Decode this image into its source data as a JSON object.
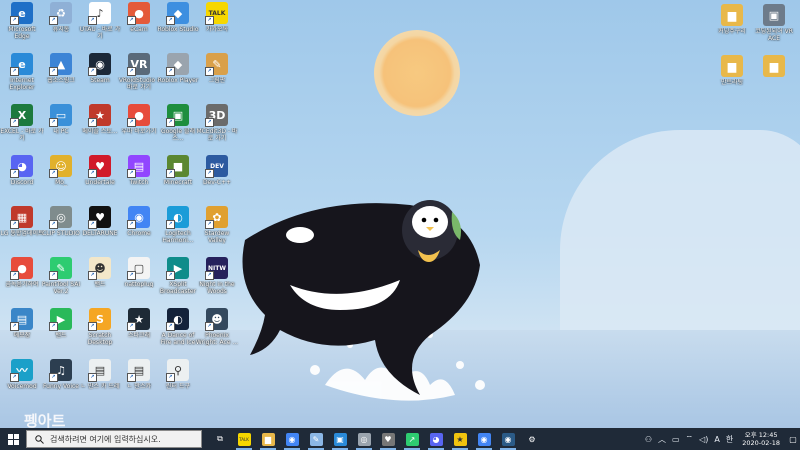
{
  "wallpaper": {
    "brand_text": "펭아트"
  },
  "desktop_icons": [
    {
      "label": "Microsoft Edge",
      "icon": "edge-icon",
      "color": "#1e6fc7",
      "glyph": "e"
    },
    {
      "label": "휴지통",
      "icon": "recycle-bin-icon",
      "color": "#8fb0d6",
      "glyph": "♻"
    },
    {
      "label": "UTAU - 바로 가기",
      "icon": "utau-icon",
      "color": "#ffffff",
      "glyph": "♪"
    },
    {
      "label": "eCam",
      "icon": "ecam-icon",
      "color": "#e45a3a",
      "glyph": "●"
    },
    {
      "label": "Roblox Studio",
      "icon": "roblox-studio-icon",
      "color": "#3d8fe0",
      "glyph": "◆"
    },
    {
      "label": "카카오톡",
      "icon": "kakaotalk-icon",
      "color": "#f6d700",
      "glyph": "TALK"
    },
    {
      "label": "Internet Explorer",
      "icon": "ie-icon",
      "color": "#2a8ad8",
      "glyph": "e"
    },
    {
      "label": "웹소스링크",
      "icon": "folder-link-icon",
      "color": "#3c84d6",
      "glyph": "▲"
    },
    {
      "label": "Steam",
      "icon": "steam-icon",
      "color": "#1b2838",
      "glyph": "◉"
    },
    {
      "label": "VRoidStudio - 바로 가기",
      "icon": "vroid-icon",
      "color": "#5a6a7a",
      "glyph": "VR"
    },
    {
      "label": "Roblox Player",
      "icon": "roblox-player-icon",
      "color": "#9aa4ae",
      "glyph": "◆"
    },
    {
      "label": "그림판",
      "icon": "paint-icon",
      "color": "#d9a04a",
      "glyph": "✎"
    },
    {
      "label": "EXCEL - 바로 가기",
      "icon": "excel-icon",
      "color": "#1d7a3e",
      "glyph": "X"
    },
    {
      "label": "내 PC",
      "icon": "this-pc-icon",
      "color": "#3a90d9",
      "glyph": "▭"
    },
    {
      "label": "메이플 스토...",
      "icon": "maplestory-icon",
      "color": "#c0392b",
      "glyph": "★"
    },
    {
      "label": "우마 바로가기",
      "icon": "uma-icon",
      "color": "#e74c3c",
      "glyph": "●"
    },
    {
      "label": "Google 클래스...",
      "icon": "google-classroom-icon",
      "color": "#1e8e3e",
      "glyph": "▣"
    },
    {
      "label": "MCEdit3D - 바로 가기",
      "icon": "3d-builder-icon",
      "color": "#6b6b6b",
      "glyph": "3D"
    },
    {
      "label": "Discord",
      "icon": "discord-icon",
      "color": "#5865f2",
      "glyph": "◕"
    },
    {
      "label": "Mo_",
      "icon": "user-folder-icon",
      "color": "#e1b12c",
      "glyph": "☺"
    },
    {
      "label": "Undertale",
      "icon": "undertale-icon",
      "color": "#d11a2a",
      "glyph": "♥"
    },
    {
      "label": "Twitch",
      "icon": "twitch-icon",
      "color": "#9146ff",
      "glyph": "▤"
    },
    {
      "label": "Minecraft",
      "icon": "minecraft-icon",
      "color": "#5b8731",
      "glyph": "■"
    },
    {
      "label": "Dev-C++",
      "icon": "devcpp-icon",
      "color": "#2c5aa0",
      "glyph": "DEV"
    },
    {
      "label": "LG 통합업데이트",
      "icon": "lg-update-icon",
      "color": "#c0392b",
      "glyph": "▦"
    },
    {
      "label": "CLIP STUDIO",
      "icon": "clip-studio-icon",
      "color": "#7f8c8d",
      "glyph": "◎"
    },
    {
      "label": "DELTARUNE",
      "icon": "deltarune-icon",
      "color": "#111111",
      "glyph": "♥"
    },
    {
      "label": "Chrome",
      "icon": "chrome-icon",
      "color": "#4285f4",
      "glyph": "◉"
    },
    {
      "label": "Logitech Harmoni...",
      "icon": "logitech-icon",
      "color": "#1b9cd8",
      "glyph": "◐"
    },
    {
      "label": "Stardew Valley",
      "icon": "stardew-icon",
      "color": "#e0a030",
      "glyph": "✿"
    },
    {
      "label": "곰녹음기하여",
      "icon": "gom-recorder-icon",
      "color": "#e74c3c",
      "glyph": "●"
    },
    {
      "label": "PaintTool SAI Ver.2",
      "icon": "paint-tool-sai-icon",
      "color": "#2ecc71",
      "glyph": "✎"
    },
    {
      "label": "밴드",
      "icon": "hamster-icon",
      "color": "#f3e7c9",
      "glyph": "☻"
    },
    {
      "label": "nattoplug",
      "icon": "file-icon",
      "color": "#f4f4f4",
      "glyph": "▢"
    },
    {
      "label": "XSplit Broadcaster",
      "icon": "xsplit-icon",
      "color": "#0f8c8a",
      "glyph": "▶"
    },
    {
      "label": "Night in the Woods",
      "icon": "night-in-the-woods-icon",
      "color": "#26215c",
      "glyph": "NITW"
    },
    {
      "label": "메모장",
      "icon": "notepad-icon",
      "color": "#3a86c8",
      "glyph": "▤"
    },
    {
      "label": "밴드",
      "icon": "line-icon",
      "color": "#2ab95a",
      "glyph": "▶"
    },
    {
      "label": "Scratch Desktop",
      "icon": "scratch-icon",
      "color": "#f5a623",
      "glyph": "S"
    },
    {
      "label": "스타크래",
      "icon": "star-icon",
      "color": "#1e2a36",
      "glyph": "★"
    },
    {
      "label": "A Dance of Fire and Ice",
      "icon": "fire-ice-icon",
      "color": "#14223a",
      "glyph": "◐"
    },
    {
      "label": "Phoenix Wright: Ace ...",
      "icon": "phoenix-wright-icon",
      "color": "#34495e",
      "glyph": "☻"
    },
    {
      "label": "Voicemod",
      "icon": "voicemod-icon",
      "color": "#1aa0c9",
      "glyph": "〰"
    },
    {
      "label": "Funny Voice",
      "icon": "funny-voice-icon",
      "color": "#2c3e50",
      "glyph": "♫"
    },
    {
      "label": "ㄴ 만스 카 드레",
      "icon": "doc-icon",
      "color": "#ecf0f1",
      "glyph": "▤"
    },
    {
      "label": "ㄴ 만스카",
      "icon": "doc2-icon",
      "color": "#ecf0f1",
      "glyph": "▤"
    },
    {
      "label": "린터 드구",
      "icon": "linter-icon",
      "color": "#ecf0f1",
      "glyph": "⚲"
    }
  ],
  "right_icons": [
    {
      "label": "커닝주구리",
      "icon": "folder-icon",
      "color": "#e8b84a",
      "glyph": "▆"
    },
    {
      "label": "코딩된되어 VR ACE",
      "icon": "app-icon",
      "color": "#6d7b8a",
      "glyph": "▣"
    },
    {
      "label": "만트라팅",
      "icon": "folder2-icon",
      "color": "#e8b84a",
      "glyph": "▆"
    },
    {
      "label": "",
      "icon": "folder3-icon",
      "color": "#e8b84a",
      "glyph": "▆"
    }
  ],
  "taskbar": {
    "search_placeholder": "검색하려면 여기에 입력하십시오.",
    "apps": [
      {
        "name": "task-view-icon",
        "color": "#1f2a38",
        "glyph": "⧉"
      },
      {
        "name": "kakaotalk-icon",
        "color": "#f6d700",
        "glyph": "TALK"
      },
      {
        "name": "file-explorer-icon",
        "color": "#e8b84a",
        "glyph": "▆"
      },
      {
        "name": "chrome-icon",
        "color": "#4285f4",
        "glyph": "◉"
      },
      {
        "name": "paint-3d-icon",
        "color": "#8bb7e6",
        "glyph": "✎"
      },
      {
        "name": "photos-icon",
        "color": "#2a8ad8",
        "glyph": "▣"
      },
      {
        "name": "clip-studio-icon",
        "color": "#9aa4ae",
        "glyph": "◎"
      },
      {
        "name": "undertale-icon",
        "color": "#777777",
        "glyph": "♥"
      },
      {
        "name": "stocks-icon",
        "color": "#2ecc71",
        "glyph": "↗"
      },
      {
        "name": "discord-icon",
        "color": "#5865f2",
        "glyph": "◕"
      },
      {
        "name": "star-icon",
        "color": "#f1c40f",
        "glyph": "★"
      },
      {
        "name": "chrome-icon-2",
        "color": "#4285f4",
        "glyph": "◉"
      },
      {
        "name": "steam-icon",
        "color": "#2b5b87",
        "glyph": "◉"
      },
      {
        "name": "settings-icon",
        "color": "#1f2a38",
        "glyph": "⚙"
      }
    ],
    "tray": {
      "language": "A",
      "ime": "한",
      "time": "오후 12:45",
      "date": "2020-02-18"
    }
  }
}
